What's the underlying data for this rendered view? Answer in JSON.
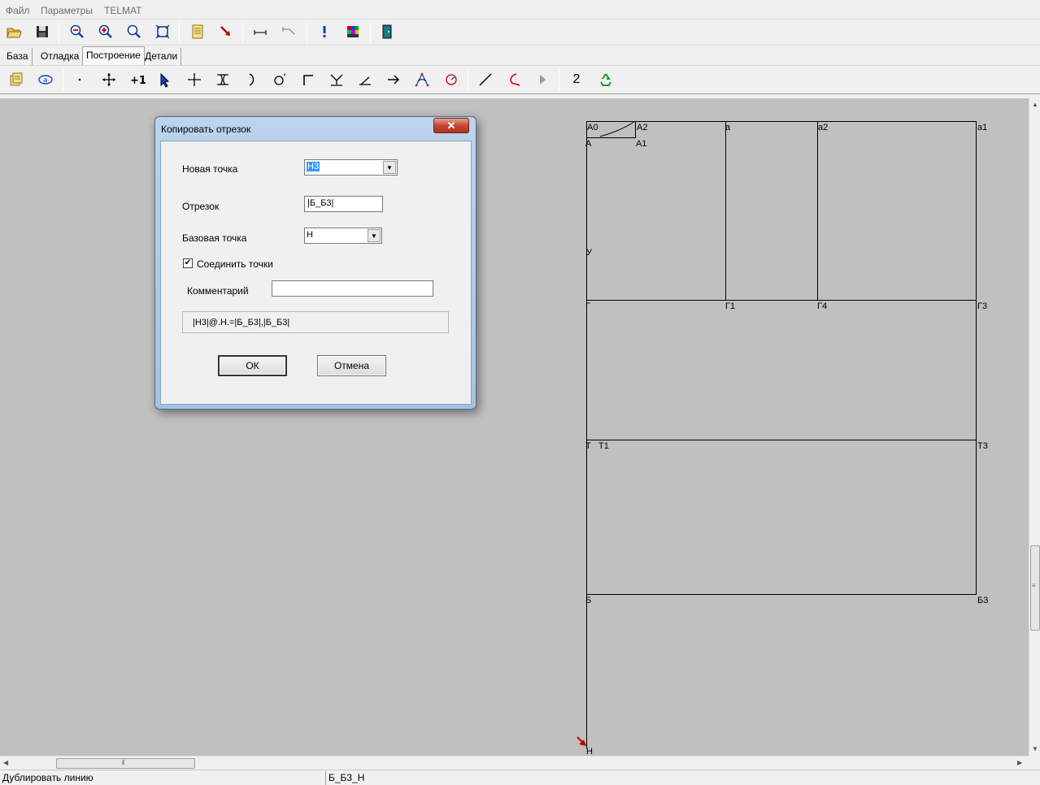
{
  "menu": {
    "file": "Файл",
    "params": "Параметры",
    "telmat": "TELMAT"
  },
  "toolbar1": {
    "icons": [
      "open-folder-icon",
      "save-icon",
      "zoom-out-icon",
      "zoom-in-icon",
      "zoom-icon",
      "zoom-fit-icon",
      "document-icon",
      "pointer-arrow-icon",
      "measure-icon",
      "measure-angle-icon",
      "exclamation-icon",
      "palette-icon",
      "exit-door-icon"
    ]
  },
  "tabs": {
    "base": "База",
    "debug": "Отладка",
    "build": "Построение",
    "details": "Детали",
    "active": "Построение"
  },
  "toolbar2": {
    "number_button": "2"
  },
  "drawing": {
    "point_labels": {
      "A0": "А0",
      "A2": "А2",
      "a": "а",
      "a2": "а2",
      "a1": "а1",
      "A": "А",
      "A1": "А1",
      "U": "У",
      "G": "Г",
      "G1": "Г1",
      "G4": "Г4",
      "G3": "Г3",
      "T": "Т",
      "T1": "Т1",
      "T3": "Т3",
      "B": "Б",
      "B3": "Б3",
      "N": "Н"
    }
  },
  "dialog": {
    "title": "Копировать отрезок",
    "close": "✕",
    "new_point_label": "Новая точка",
    "new_point_value": "Н3",
    "segment_label": "Отрезок",
    "segment_value": "|Б_Б3|",
    "base_point_label": "Базовая точка",
    "base_point_value": "Н",
    "connect_label": "Соединить точки",
    "connect_checked": true,
    "connect_mark": "✔",
    "comment_label": "Комментарий",
    "comment_value": "",
    "formula": "|Н3|@.Н.=|Б_Б3|,|Б_Б3|",
    "ok": "ОК",
    "cancel": "Отмена"
  },
  "status": {
    "left": "Дублировать линию",
    "middle": "Б_Б3_Н"
  }
}
